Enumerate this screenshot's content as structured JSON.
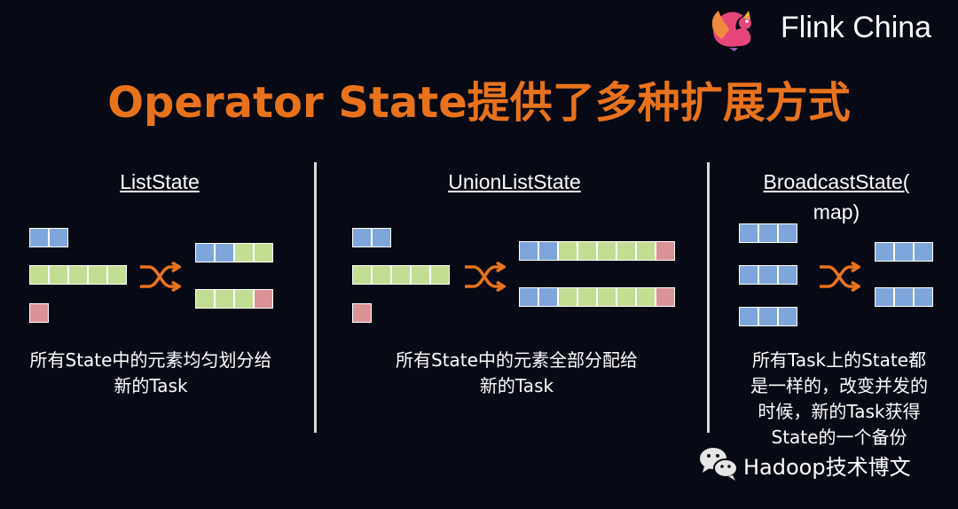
{
  "brand": {
    "name": "Flink China"
  },
  "title": "Operator State提供了多种扩展方式",
  "panels": [
    {
      "heading": "ListState",
      "description_lines": [
        "所有State中的元素均匀划分给",
        "新的Task"
      ],
      "input_blocks": [
        [
          "b",
          "b"
        ],
        [
          "g",
          "g",
          "g",
          "g",
          "g"
        ],
        [
          "r"
        ]
      ],
      "output_blocks": [
        [
          "b",
          "b",
          "g",
          "g"
        ],
        [
          "g",
          "g",
          "g",
          "r"
        ]
      ]
    },
    {
      "heading": "UnionListState",
      "description_lines": [
        "所有State中的元素全部分配给",
        "新的Task"
      ],
      "input_blocks": [
        [
          "b",
          "b"
        ],
        [
          "g",
          "g",
          "g",
          "g",
          "g"
        ],
        [
          "r"
        ]
      ],
      "output_blocks": [
        [
          "b",
          "b",
          "g",
          "g",
          "g",
          "g",
          "g",
          "r"
        ],
        [
          "b",
          "b",
          "g",
          "g",
          "g",
          "g",
          "g",
          "r"
        ]
      ]
    },
    {
      "heading_lines": [
        "BroadcastState(",
        "map)"
      ],
      "description_lines": [
        "所有Task上的State都",
        "是一样的，改变并发的",
        "时候，新的Task获得",
        "State的一个备份"
      ],
      "input_blocks": [
        [
          "b",
          "b",
          "b"
        ],
        [
          "b",
          "b",
          "b"
        ],
        [
          "b",
          "b",
          "b"
        ]
      ],
      "output_blocks": [
        [
          "b",
          "b",
          "b"
        ],
        [
          "b",
          "b",
          "b"
        ]
      ]
    }
  ],
  "colors": {
    "title": "#e8731c",
    "blue": "#7fa6da",
    "green": "#c3dd92",
    "red": "#da9497",
    "arrow": "#e8731c",
    "background": "#070914"
  },
  "icons": {
    "shuffle": "shuffle-icon",
    "logo": "squirrel-logo-icon",
    "wechat": "wechat-icon"
  },
  "watermark": {
    "text": "Hadoop技术博文"
  }
}
